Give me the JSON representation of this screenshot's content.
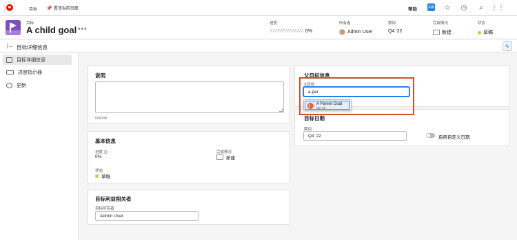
{
  "topbar": {
    "nav_goals": "目标",
    "nav_pin": "置顶当前页面",
    "help": "帮助",
    "notification_count": "215",
    "icons": [
      "star-icon",
      "clock-icon",
      "search-icon",
      "apps-grid-icon"
    ]
  },
  "header": {
    "breadcrumb": "目标",
    "title": "A child goal",
    "more": "•••",
    "progress_label": "进度",
    "progress_value": "0%",
    "progress_fraction": 0,
    "owner_label": "所有者",
    "owner_value": "Admin User",
    "period_label": "期间",
    "period_value": "Q4 '22",
    "completion_label": "完成情况",
    "completion_value": "新建",
    "status_label": "状态",
    "status_value": "草稿"
  },
  "subbar": {
    "title": "目标详细信息"
  },
  "sidebar": {
    "items": [
      {
        "label": "目标详细信息",
        "active": true
      },
      {
        "label": "进度指示器",
        "active": false
      },
      {
        "label": "更新",
        "active": false
      }
    ]
  },
  "description": {
    "title": "说明",
    "counter": "0/4000"
  },
  "basic": {
    "title": "基本信息",
    "progress_label": "进度",
    "progress_value": "0%",
    "completion_label": "完成情况",
    "completion_value": "新建",
    "status_label": "状态",
    "status_value": "草稿"
  },
  "stakeholders": {
    "title": "目标利益相关者",
    "owner_label": "目标所有者",
    "owner_value": "Admin User"
  },
  "parent": {
    "title": "父目标信息",
    "field_label": "父目标",
    "input_value": "a par",
    "suggestion_name": "A Parent Goal",
    "suggestion_period": "Q2 '23"
  },
  "dates": {
    "title": "目标日期",
    "period_label": "期间",
    "period_value": "Q4 '22",
    "toggle_label": "启用自定义日期"
  },
  "colors": {
    "accent": "#2680eb",
    "highlight": "#d54e1f",
    "goal_icon": "#7e4fbf",
    "status_draft": "#e6c21e"
  }
}
